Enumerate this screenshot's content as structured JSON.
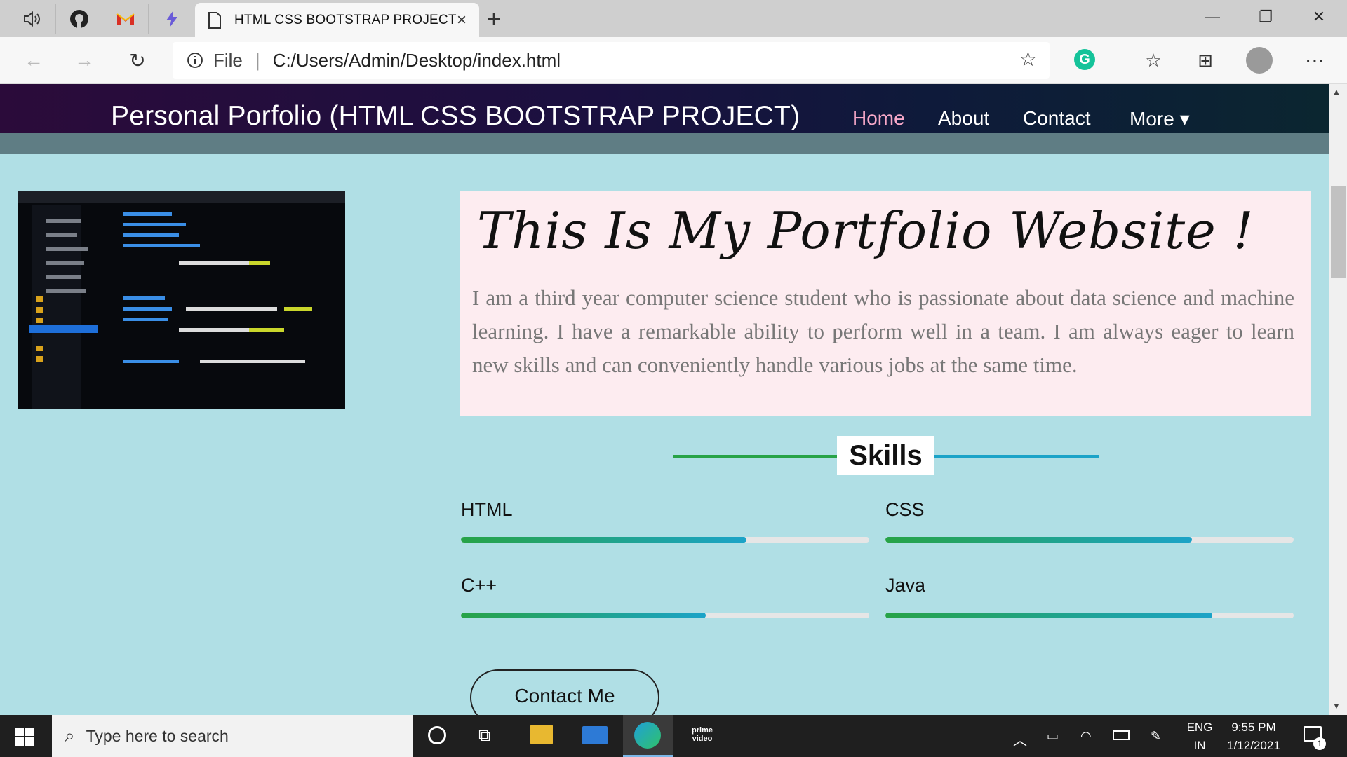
{
  "browser": {
    "tab_title": "HTML CSS BOOTSTRAP PROJECT",
    "close_glyph": "×",
    "new_tab_glyph": "+",
    "address_scheme": "File",
    "address_url": "C:/Users/Admin/Desktop/index.html",
    "window_controls": [
      "—",
      "❐",
      "✕"
    ]
  },
  "site": {
    "brand": "Personal Porfolio (HTML CSS BOOTSTRAP PROJECT)",
    "nav": [
      {
        "label": "Home",
        "active": true
      },
      {
        "label": "About",
        "active": false
      },
      {
        "label": "Contact",
        "active": false
      },
      {
        "label": "More ▾",
        "active": false
      }
    ],
    "intro_title": "This Is My Portfolio Website !",
    "intro_text": "I am a third year computer science student who is passionate about data science and machine learning. I have a remarkable ability to perform well in a team. I am always eager to learn new skills and can conveniently handle various jobs at the same time.",
    "skills_heading": "Skills",
    "skills": [
      {
        "name": "HTML",
        "level": 0.7
      },
      {
        "name": "CSS",
        "level": 0.75
      },
      {
        "name": "C++",
        "level": 0.6
      },
      {
        "name": "Java",
        "level": 0.8
      }
    ],
    "contact_button": "Contact Me"
  },
  "colors": {
    "page_bg": "#b0dfe5",
    "nav_active": "#f7a8c8",
    "intro_bg": "#fdecf0",
    "bar_start": "#27a347",
    "bar_end": "#1ba3c8"
  },
  "taskbar": {
    "search_placeholder": "Type here to search",
    "lang_top": "ENG",
    "lang_bottom": "IN",
    "time": "9:55 PM",
    "date": "1/12/2021",
    "notification_count": "1",
    "prime_label": "prime video"
  }
}
